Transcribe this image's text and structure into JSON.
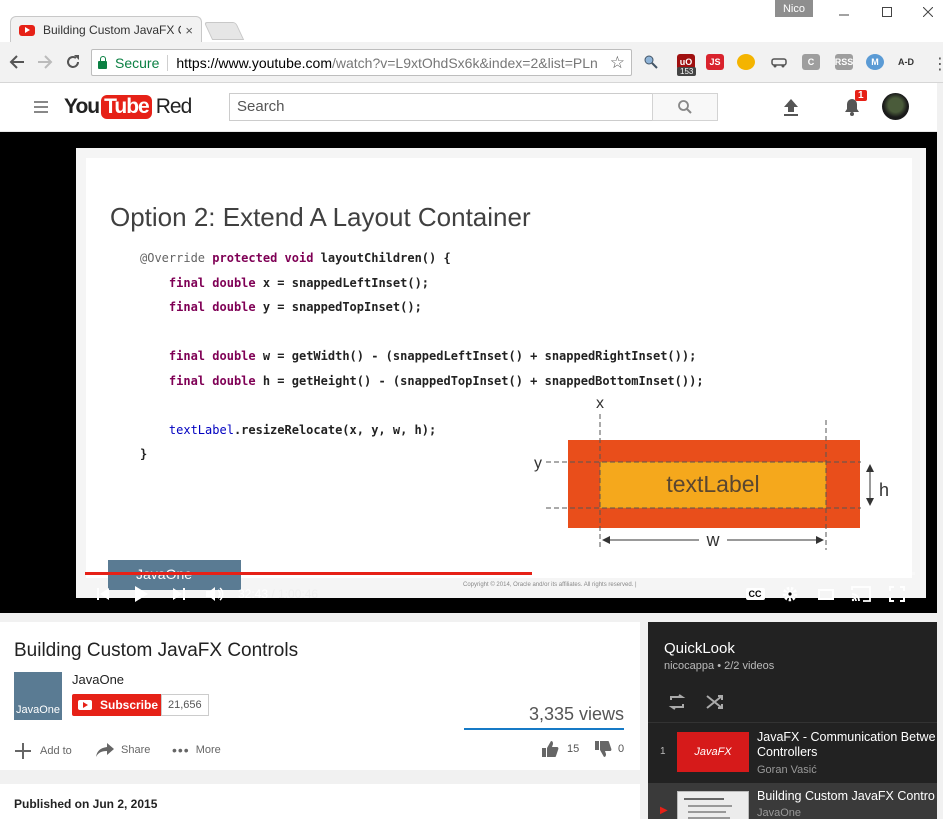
{
  "browser": {
    "tab_title": "Building Custom JavaFX C",
    "tab_close": "×",
    "profile_name": "Nico",
    "secure_label": "Secure",
    "url_host": "https://www.youtube.com",
    "url_path": "/watch?v=L9xtOhdSx6k&index=2&list=PLn",
    "ext_badge_count": "153"
  },
  "youtube": {
    "logo_you": "You",
    "logo_tube": "Tube",
    "logo_red": "Red",
    "search_placeholder": "Search",
    "notification_count": "1"
  },
  "player": {
    "current_time": "32:43",
    "duration": "/ 1:00:46",
    "played_fraction": 0.539,
    "loaded_fraction": 0.54,
    "cc_label": "CC"
  },
  "slide": {
    "title": "Option 2: Extend A Layout Container",
    "code_lines": [
      "@Override protected void layoutChildren() {",
      "    final double x = snappedLeftInset();",
      "    final double y = snappedTopInset();",
      "",
      "    final double w = getWidth() - (snappedLeftInset() + snappedRightInset());",
      "    final double h = getHeight() - (snappedTopInset() + snappedBottomInset());",
      "",
      "    textLabel.resizeRelocate(x, y, w, h);",
      "}"
    ],
    "diagram_label": "textLabel",
    "axis_x": "x",
    "axis_y": "y",
    "axis_w": "w",
    "axis_h": "h",
    "watermark": "JavaOne",
    "copyright": "Copyright © 2014, Oracle and/or its affiliates. All rights reserved.  |"
  },
  "video": {
    "title": "Building Custom JavaFX Controls",
    "channel": "JavaOne",
    "channel_avatar_text": "JavaOne",
    "subscribe_label": "Subscribe",
    "subscriber_count": "21,656",
    "views": "3,335 views",
    "add_to": "Add to",
    "share": "Share",
    "more": "More",
    "likes": "15",
    "dislikes": "0",
    "published": "Published on Jun 2, 2015"
  },
  "playlist": {
    "title": "QuickLook",
    "meta": "nicocappa • 2/2 videos",
    "items": [
      {
        "index": "1",
        "title": "JavaFX - Communication Betwe Controllers",
        "channel": "Goran Vasić",
        "thumb_text": "JavaFX"
      },
      {
        "index": "▶",
        "title": "Building Custom JavaFX Contro",
        "channel": "JavaOne"
      }
    ]
  },
  "colors": {
    "youtube_red": "#e62117",
    "progress_red": "#e62117",
    "diagram_outer": "#e94e1b",
    "diagram_inner": "#f5a81c",
    "secure_green": "#0b8043",
    "link_blue": "#167ac6"
  }
}
